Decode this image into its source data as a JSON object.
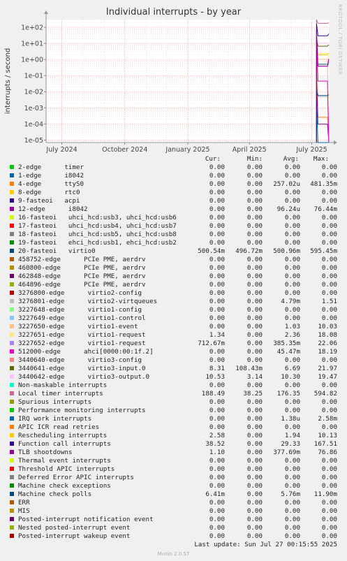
{
  "title": "Individual interrupts - by year",
  "side_label": "RRDTOOL / TOBI OETIKER",
  "footer": {
    "last_update": "Last update: Sun Jul 27 00:15:55 2025",
    "munin": "Munin 2.0.57"
  },
  "legend_header": {
    "cur": "Cur:",
    "min": "Min:",
    "avg": "Avg:",
    "max": "Max:"
  },
  "chart_data": {
    "type": "line",
    "title": "Individual interrupts - by year",
    "ylabel": "interrupts / second",
    "yscale": "log",
    "ylim": [
      7e-06,
      300
    ],
    "y_ticks": [
      "1e-05",
      "1e-04",
      "1e-03",
      "1e-02",
      "1e-01",
      "1e+00",
      "1e+01",
      "1e+02"
    ],
    "x_ticks": [
      "July 2024",
      "October 2024",
      "January 2025",
      "April 2025",
      "July 2025"
    ],
    "x_range": [
      "2024-06-08",
      "2025-07-27"
    ],
    "grid": true,
    "data_start": "2025-07-08",
    "series": [
      {
        "name": "2-edge      timer",
        "color": "#00cc00",
        "cur": "0.00",
        "min": "0.00",
        "avg": "0.00",
        "max": "0.00"
      },
      {
        "name": "1-edge      i8042",
        "color": "#0066b3",
        "cur": "0.00",
        "min": "0.00",
        "avg": "0.00",
        "max": "0.00"
      },
      {
        "name": "4-edge      ttyS0",
        "color": "#ff8000",
        "cur": "0.00",
        "min": "0.00",
        "avg": "257.02u",
        "max": "481.35m"
      },
      {
        "name": "8-edge      rtc0",
        "color": "#ffcc00",
        "cur": "0.00",
        "min": "0.00",
        "avg": "0.00",
        "max": "0.00"
      },
      {
        "name": "9-fasteoi   acpi",
        "color": "#330099",
        "cur": "0.00",
        "min": "0.00",
        "avg": "0.00",
        "max": "0.00"
      },
      {
        "name": "12-edge      i8042",
        "color": "#990099",
        "cur": "0.00",
        "min": "0.00",
        "avg": "96.24u",
        "max": "76.44m"
      },
      {
        "name": "16-fasteoi   uhci_hcd:usb3, uhci_hcd:usb6",
        "color": "#ccff00",
        "cur": "0.00",
        "min": "0.00",
        "avg": "0.00",
        "max": "0.00"
      },
      {
        "name": "17-fasteoi   uhci_hcd:usb4, uhci_hcd:usb7",
        "color": "#ff0000",
        "cur": "0.00",
        "min": "0.00",
        "avg": "0.00",
        "max": "0.00"
      },
      {
        "name": "18-fasteoi   uhci_hcd:usb5, uhci_hcd:usb8",
        "color": "#808080",
        "cur": "0.00",
        "min": "0.00",
        "avg": "0.00",
        "max": "0.00"
      },
      {
        "name": "19-fasteoi   ehci_hcd:usb1, ehci_hcd:usb2",
        "color": "#008f00",
        "cur": "0.00",
        "min": "0.00",
        "avg": "0.00",
        "max": "0.00"
      },
      {
        "name": "20-fasteoi   virtio0",
        "color": "#00487d",
        "cur": "500.54m",
        "min": "496.72m",
        "avg": "500.96m",
        "max": "595.45m"
      },
      {
        "name": "458752-edge      PCIe PME, aerdrv",
        "color": "#b35a00",
        "cur": "0.00",
        "min": "0.00",
        "avg": "0.00",
        "max": "0.00"
      },
      {
        "name": "460800-edge      PCIe PME, aerdrv",
        "color": "#b38f00",
        "cur": "0.00",
        "min": "0.00",
        "avg": "0.00",
        "max": "0.00"
      },
      {
        "name": "462848-edge      PCIe PME, aerdrv",
        "color": "#6b006b",
        "cur": "0.00",
        "min": "0.00",
        "avg": "0.00",
        "max": "0.00"
      },
      {
        "name": "464896-edge      PCIe PME, aerdrv",
        "color": "#8fb300",
        "cur": "0.00",
        "min": "0.00",
        "avg": "0.00",
        "max": "0.00"
      },
      {
        "name": "3276800-edge      virtio2-config",
        "color": "#b30000",
        "cur": "0.00",
        "min": "0.00",
        "avg": "0.00",
        "max": "0.00"
      },
      {
        "name": "3276801-edge      virtio2-virtqueues",
        "color": "#bebebe",
        "cur": "0.00",
        "min": "0.00",
        "avg": "4.79m",
        "max": "1.51"
      },
      {
        "name": "3227648-edge      virtio1-config",
        "color": "#80ff80",
        "cur": "0.00",
        "min": "0.00",
        "avg": "0.00",
        "max": "0.00"
      },
      {
        "name": "3227649-edge      virtio1-control",
        "color": "#80c9ff",
        "cur": "0.00",
        "min": "0.00",
        "avg": "0.00",
        "max": "0.00"
      },
      {
        "name": "3227650-edge      virtio1-event",
        "color": "#ffc080",
        "cur": "0.00",
        "min": "0.00",
        "avg": "1.03",
        "max": "10.03"
      },
      {
        "name": "3227651-edge      virtio1-request",
        "color": "#ffe680",
        "cur": "1.34",
        "min": "0.00",
        "avg": "2.36",
        "max": "18.08"
      },
      {
        "name": "3227652-edge      virtio1-request",
        "color": "#aa80ff",
        "cur": "712.67m",
        "min": "0.00",
        "avg": "385.35m",
        "max": "22.06"
      },
      {
        "name": "512000-edge      ahci[0000:00:1f.2]",
        "color": "#ee00cc",
        "cur": "0.00",
        "min": "0.00",
        "avg": "45.47m",
        "max": "18.19"
      },
      {
        "name": "3440640-edge      virtio3-config",
        "color": "#ff8080",
        "cur": "0.00",
        "min": "0.00",
        "avg": "0.00",
        "max": "0.00"
      },
      {
        "name": "3440641-edge      virtio3-input.0",
        "color": "#666600",
        "cur": "8.31",
        "min": "108.43m",
        "avg": "6.69",
        "max": "21.97"
      },
      {
        "name": "3440642-edge      virtio3-output.0",
        "color": "#ffbfff",
        "cur": "10.53",
        "min": "3.14",
        "avg": "10.30",
        "max": "19.47"
      },
      {
        "name": "Non-maskable interrupts",
        "color": "#00ffcc",
        "cur": "0.00",
        "min": "0.00",
        "avg": "0.00",
        "max": "0.00"
      },
      {
        "name": "Local timer interrupts",
        "color": "#cc6699",
        "cur": "188.49",
        "min": "38.25",
        "avg": "176.35",
        "max": "594.82"
      },
      {
        "name": "Spurious interrupts",
        "color": "#999900",
        "cur": "0.00",
        "min": "0.00",
        "avg": "0.00",
        "max": "0.00"
      },
      {
        "name": "Performance monitoring interrupts",
        "color": "#00cc00",
        "cur": "0.00",
        "min": "0.00",
        "avg": "0.00",
        "max": "0.00"
      },
      {
        "name": "IRQ work interrupts",
        "color": "#0066b3",
        "cur": "0.00",
        "min": "0.00",
        "avg": "1.38u",
        "max": "2.58m"
      },
      {
        "name": "APIC ICR read retries",
        "color": "#ff8000",
        "cur": "0.00",
        "min": "0.00",
        "avg": "0.00",
        "max": "0.00"
      },
      {
        "name": "Rescheduling interrupts",
        "color": "#ffcc00",
        "cur": "2.58",
        "min": "0.00",
        "avg": "1.94",
        "max": "10.13"
      },
      {
        "name": "Function call interrupts",
        "color": "#330099",
        "cur": "38.52",
        "min": "0.00",
        "avg": "29.33",
        "max": "167.51"
      },
      {
        "name": "TLB shootdowns",
        "color": "#990099",
        "cur": "1.10",
        "min": "0.00",
        "avg": "377.69m",
        "max": "76.86"
      },
      {
        "name": "Thermal event interrupts",
        "color": "#ccff00",
        "cur": "0.00",
        "min": "0.00",
        "avg": "0.00",
        "max": "0.00"
      },
      {
        "name": "Threshold APIC interrupts",
        "color": "#ff0000",
        "cur": "0.00",
        "min": "0.00",
        "avg": "0.00",
        "max": "0.00"
      },
      {
        "name": "Deferred Error APIC interrupts",
        "color": "#808080",
        "cur": "0.00",
        "min": "0.00",
        "avg": "0.00",
        "max": "0.00"
      },
      {
        "name": "Machine check exceptions",
        "color": "#008f00",
        "cur": "0.00",
        "min": "0.00",
        "avg": "0.00",
        "max": "0.00"
      },
      {
        "name": "Machine check polls",
        "color": "#00487d",
        "cur": "6.41m",
        "min": "0.00",
        "avg": "5.76m",
        "max": "11.90m"
      },
      {
        "name": "ERR",
        "color": "#b35a00",
        "cur": "0.00",
        "min": "0.00",
        "avg": "0.00",
        "max": "0.00"
      },
      {
        "name": "MIS",
        "color": "#b38f00",
        "cur": "0.00",
        "min": "0.00",
        "avg": "0.00",
        "max": "0.00"
      },
      {
        "name": "Posted-interrupt notification event",
        "color": "#6b006b",
        "cur": "0.00",
        "min": "0.00",
        "avg": "0.00",
        "max": "0.00"
      },
      {
        "name": "Nested posted-interrupt event",
        "color": "#8fb300",
        "cur": "0.00",
        "min": "0.00",
        "avg": "0.00",
        "max": "0.00"
      },
      {
        "name": "Posted-interrupt wakeup event",
        "color": "#b30000",
        "cur": "0.00",
        "min": "0.00",
        "avg": "0.00",
        "max": "0.00"
      }
    ]
  }
}
